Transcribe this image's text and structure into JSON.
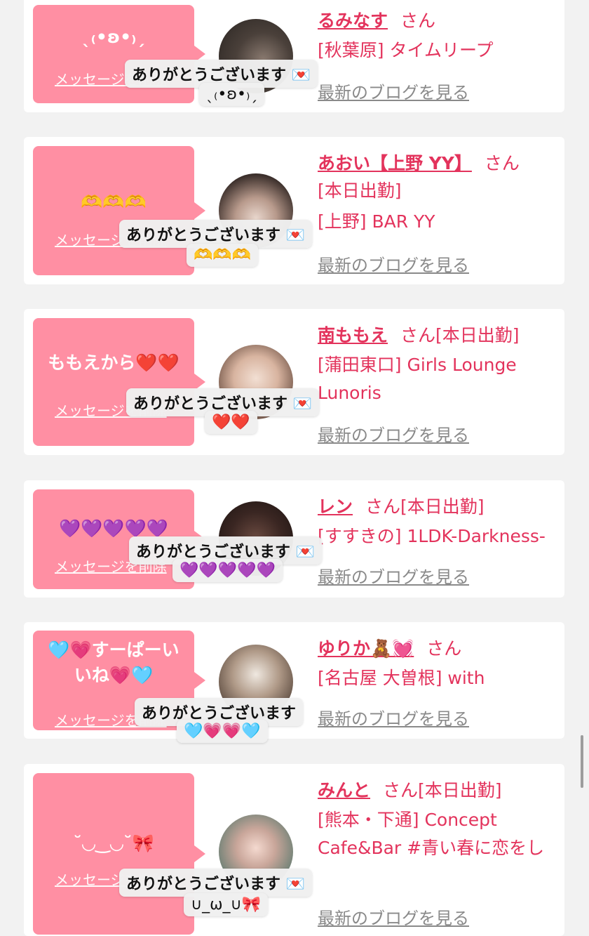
{
  "delete_label": "メッセージを削除",
  "blog_label": "最新のブログを見る",
  "san_label": "さん",
  "today_label": "[本日出勤]",
  "toast_text": "ありがとうございます",
  "cards": [
    {
      "message": "ˎ₍•ʚ•₎ˏ",
      "name": "るみなす",
      "today": false,
      "info": "[秋葉原] タイムリープ",
      "toast_text": "ありがとうございます 💌",
      "toast_reply": "ˎ₍•ʚ•₎ˏ"
    },
    {
      "message": "🫶🫶🫶",
      "name": "あおい【上野 YY】",
      "today": false,
      "today_line": "[本日出勤]",
      "info": "[上野] BAR YY",
      "toast_text": "ありがとうございます 💌",
      "toast_reply": "🫶🫶🫶"
    },
    {
      "message": "ももえから❤️❤️",
      "name": "南ももえ",
      "today": true,
      "info": "[蒲田東口] Girls Lounge Lunoris",
      "toast_text": "ありがとうございます 💌",
      "toast_reply": "❤️❤️"
    },
    {
      "message": "💜💜💜💜💜",
      "name": "レン",
      "today": true,
      "info": "[すすきの] 1LDK-Darkness-",
      "toast_text": "ありがとうございます 💌",
      "toast_reply": "💜💜💜💜💜"
    },
    {
      "message": "🩵💗すーぱーいいね💗🩵",
      "name": "ゆりか🧸💓",
      "today": false,
      "info": "[名古屋 大曽根] with",
      "toast_text": "ありがとうございます",
      "toast_reply": "🩵💗💗🩵"
    },
    {
      "message": "˘◡‿◡˘🎀",
      "name": "みんと",
      "today": true,
      "info": "[熊本・下通] Concept Cafe&Bar #青い春に恋をし",
      "toast_text": "ありがとうございます 💌",
      "toast_reply": "∪_ω_∪🎀"
    }
  ],
  "colors": {
    "background": "#f2f2f2",
    "bubble": "#ff8fa3",
    "accent": "#e3335c",
    "link_gray": "#8a8a8a"
  }
}
